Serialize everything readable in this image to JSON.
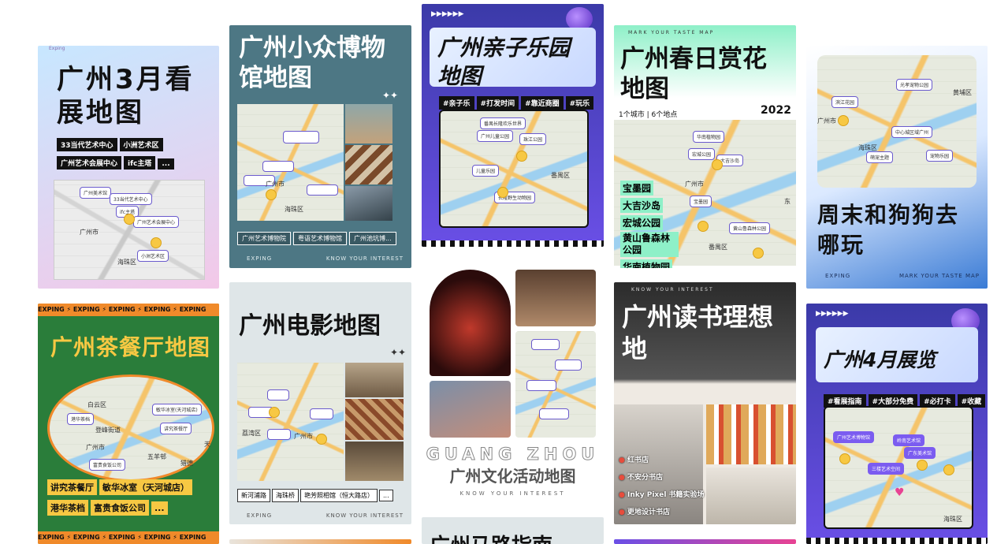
{
  "cards": {
    "c1": {
      "title": "广州3月看展地图",
      "brand_strip": "Exping",
      "tags": [
        "33当代艺术中心",
        "小洲艺术区",
        "广州艺术会展中心",
        "ifc主塔",
        "..."
      ],
      "map_labels": [
        "广州市",
        "海珠区"
      ],
      "pins": [
        "广州美术馆",
        "33当代艺术中心",
        "ifc主塔",
        "广州艺术会展中心",
        "小洲艺术区"
      ]
    },
    "c2": {
      "title": "广州小众博物馆地图",
      "tags": [
        "广州艺术博物院",
        "粤语艺术博物馆",
        "广州池坑博..."
      ],
      "footer_left": "EXPING",
      "footer_right": "KNOW YOUR INTEREST",
      "map_labels": [
        "广州市",
        "海珠区"
      ]
    },
    "c3": {
      "title": "广州亲子乐园地图",
      "tags": [
        "#亲子乐",
        "#打发时间",
        "#靠近商圈",
        "#玩乐"
      ],
      "map_labels": [
        "番禺区"
      ],
      "pins": [
        "番禺长隆欢乐世界",
        "广州儿童公园",
        "珠江公园",
        "儿童乐园",
        "长隆野生动物园"
      ]
    },
    "c4": {
      "header": "MARK YOUR TASTE MAP",
      "title": "广州春日赏花地图",
      "year": "2022",
      "stats": "1个城市 | 6个地点",
      "map_labels": [
        "广州市",
        "番禺区",
        "东"
      ],
      "pins": [
        "华南植物园",
        "宏城公园",
        "大吉沙岛",
        "宝墨园",
        "黄山鲁森林公园"
      ],
      "list": [
        "宝墨园",
        "大吉沙岛",
        "宏城公园",
        "黄山鲁森林公园",
        "华南植物园"
      ]
    },
    "c5": {
      "title": "周末和狗狗去哪玩",
      "footer_left": "EXPING",
      "footer_right": "MARK YOUR TASTE MAP",
      "map_labels": [
        "广州市",
        "海珠区",
        "黄埔区"
      ],
      "pins": [
        "光孝宠物公园",
        "滨江花园",
        "中心城区域广州",
        "萌宠主题",
        "宠物乐园"
      ]
    },
    "c6": {
      "ticker": "EXPING",
      "title": "广州茶餐厅地图",
      "map_labels": [
        "白云区",
        "登峰街道",
        "广州市",
        "五羊邨",
        "猎德",
        "天"
      ],
      "pins": [
        "港华茶档",
        "敏华冰室(天河城店)",
        "讲究茶餐厅",
        "富贵食饭公司"
      ],
      "tags": [
        "讲究茶餐厅",
        "敏华冰室（天河城店）",
        "港华茶档",
        "富贵食饭公司",
        "..."
      ]
    },
    "c7": {
      "title": "广州电影地图",
      "tags": [
        "新河浦路",
        "海珠桥",
        "艳芳照相馆（恒大路店）",
        "..."
      ],
      "footer_left": "EXPING",
      "footer_right": "KNOW YOUR INTEREST",
      "map_labels": [
        "广州市",
        "荔湾区"
      ]
    },
    "c8": {
      "title_en": "GUANG ZHOU",
      "title": "广州文化活动地图",
      "sub": "KNOW YOUR INTEREST"
    },
    "c9": {
      "header": "KNOW YOUR INTEREST",
      "title": "广州读书理想地",
      "list": [
        "红书店",
        "不安分书店",
        "Inky Pixel 书籍实验场",
        "更地设计书店"
      ]
    },
    "c10": {
      "title": "广州4月展览",
      "tags": [
        "#看展指南",
        "#大部分免费",
        "#必打卡",
        "#收藏"
      ],
      "map_labels": [
        "海珠区"
      ],
      "pins": [
        "广州艺术博物馆",
        "岭南艺术馆",
        "广东美术馆",
        "三楼艺术空间"
      ]
    },
    "c11": {
      "title": "广州马路指南"
    }
  },
  "colors": {
    "purple": "#6a4fe6",
    "navy": "#3b3aa8",
    "green": "#2a7d3a",
    "orange": "#f08a2a",
    "yellow": "#f7c843",
    "mint": "#8ef0c8",
    "slate": "#4d7784"
  }
}
